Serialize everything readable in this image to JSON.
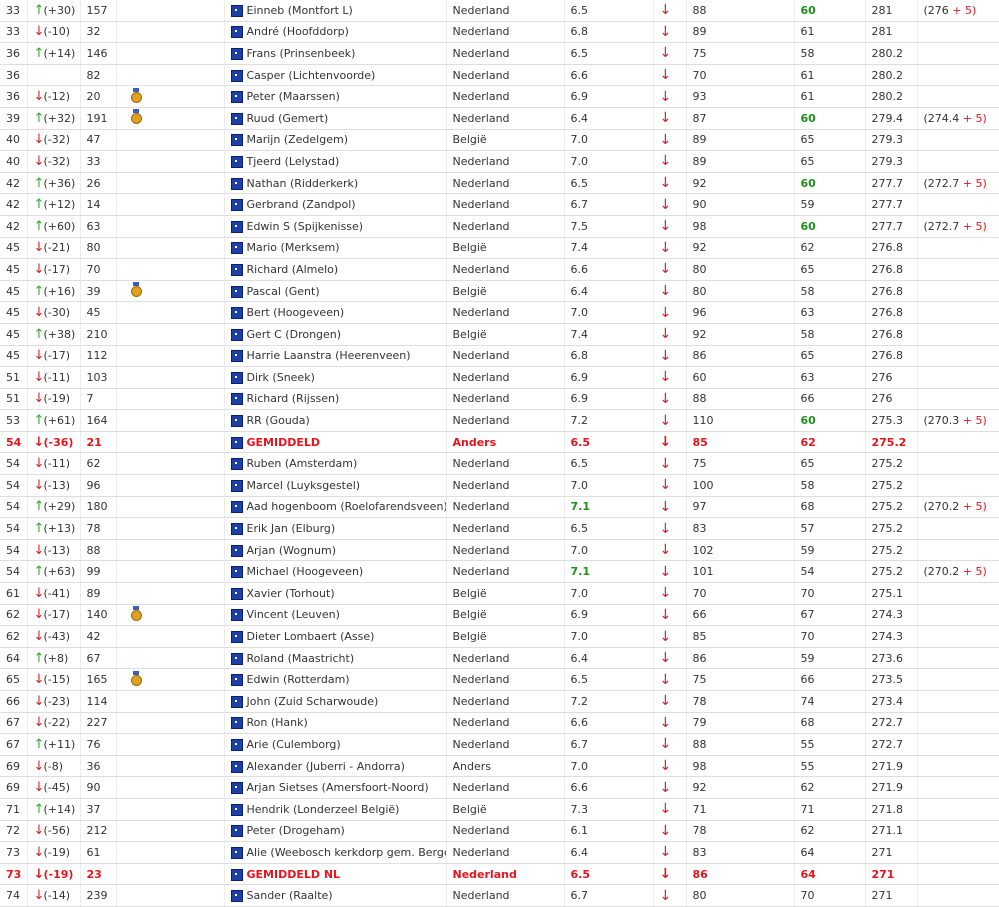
{
  "rows": [
    {
      "rank": "33",
      "dir": "up",
      "change": "(+30)",
      "prev": "157",
      "medal": "",
      "name": "Einneb (Montfort L)",
      "country": "Nederland",
      "score": "6.5",
      "score_green": false,
      "v1": "88",
      "v2": "60",
      "v2_green": true,
      "total": "281",
      "bonus_base": "(276",
      "bonus_add": "+ 5)",
      "avg": false
    },
    {
      "rank": "33",
      "dir": "down",
      "change": "(-10)",
      "prev": "32",
      "medal": "",
      "name": "André (Hoofddorp)",
      "country": "Nederland",
      "score": "6.8",
      "score_green": false,
      "v1": "89",
      "v2": "61",
      "v2_green": false,
      "total": "281",
      "bonus_base": "",
      "bonus_add": "",
      "avg": false
    },
    {
      "rank": "36",
      "dir": "up",
      "change": "(+14)",
      "prev": "146",
      "medal": "",
      "name": "Frans (Prinsenbeek)",
      "country": "Nederland",
      "score": "6.5",
      "score_green": false,
      "v1": "75",
      "v2": "58",
      "v2_green": false,
      "total": "280.2",
      "bonus_base": "",
      "bonus_add": "",
      "avg": false
    },
    {
      "rank": "36",
      "dir": "",
      "change": "",
      "prev": "82",
      "medal": "",
      "name": "Casper (Lichtenvoorde)",
      "country": "Nederland",
      "score": "6.6",
      "score_green": false,
      "v1": "70",
      "v2": "61",
      "v2_green": false,
      "total": "280.2",
      "bonus_base": "",
      "bonus_add": "",
      "avg": false
    },
    {
      "rank": "36",
      "dir": "down",
      "change": "(-12)",
      "prev": "20",
      "medal": "medal-icon",
      "name": "Peter (Maarssen)",
      "country": "Nederland",
      "score": "6.9",
      "score_green": false,
      "v1": "93",
      "v2": "61",
      "v2_green": false,
      "total": "280.2",
      "bonus_base": "",
      "bonus_add": "",
      "avg": false
    },
    {
      "rank": "39",
      "dir": "up",
      "change": "(+32)",
      "prev": "191",
      "medal": "medal-icon",
      "name": "Ruud (Gemert)",
      "country": "Nederland",
      "score": "6.4",
      "score_green": false,
      "v1": "87",
      "v2": "60",
      "v2_green": true,
      "total": "279.4",
      "bonus_base": "(274.4",
      "bonus_add": "+ 5)",
      "avg": false
    },
    {
      "rank": "40",
      "dir": "down",
      "change": "(-32)",
      "prev": "47",
      "medal": "",
      "name": "Marijn (Zedelgem)",
      "country": "België",
      "score": "7.0",
      "score_green": false,
      "v1": "89",
      "v2": "65",
      "v2_green": false,
      "total": "279.3",
      "bonus_base": "",
      "bonus_add": "",
      "avg": false
    },
    {
      "rank": "40",
      "dir": "down",
      "change": "(-32)",
      "prev": "33",
      "medal": "",
      "name": "Tjeerd (Lelystad)",
      "country": "Nederland",
      "score": "7.0",
      "score_green": false,
      "v1": "89",
      "v2": "65",
      "v2_green": false,
      "total": "279.3",
      "bonus_base": "",
      "bonus_add": "",
      "avg": false
    },
    {
      "rank": "42",
      "dir": "up",
      "change": "(+36)",
      "prev": "26",
      "medal": "",
      "name": "Nathan (Ridderkerk)",
      "country": "Nederland",
      "score": "6.5",
      "score_green": false,
      "v1": "92",
      "v2": "60",
      "v2_green": true,
      "total": "277.7",
      "bonus_base": "(272.7",
      "bonus_add": "+ 5)",
      "avg": false
    },
    {
      "rank": "42",
      "dir": "up",
      "change": "(+12)",
      "prev": "14",
      "medal": "",
      "name": "Gerbrand (Zandpol)",
      "country": "Nederland",
      "score": "6.7",
      "score_green": false,
      "v1": "90",
      "v2": "59",
      "v2_green": false,
      "total": "277.7",
      "bonus_base": "",
      "bonus_add": "",
      "avg": false
    },
    {
      "rank": "42",
      "dir": "up",
      "change": "(+60)",
      "prev": "63",
      "medal": "",
      "name": "Edwin S (Spijkenisse)",
      "country": "Nederland",
      "score": "7.5",
      "score_green": false,
      "v1": "98",
      "v2": "60",
      "v2_green": true,
      "total": "277.7",
      "bonus_base": "(272.7",
      "bonus_add": "+ 5)",
      "avg": false
    },
    {
      "rank": "45",
      "dir": "down",
      "change": "(-21)",
      "prev": "80",
      "medal": "",
      "name": "Mario (Merksem)",
      "country": "België",
      "score": "7.4",
      "score_green": false,
      "v1": "92",
      "v2": "62",
      "v2_green": false,
      "total": "276.8",
      "bonus_base": "",
      "bonus_add": "",
      "avg": false
    },
    {
      "rank": "45",
      "dir": "down",
      "change": "(-17)",
      "prev": "70",
      "medal": "",
      "name": "Richard (Almelo)",
      "country": "Nederland",
      "score": "6.6",
      "score_green": false,
      "v1": "80",
      "v2": "65",
      "v2_green": false,
      "total": "276.8",
      "bonus_base": "",
      "bonus_add": "",
      "avg": false
    },
    {
      "rank": "45",
      "dir": "up",
      "change": "(+16)",
      "prev": "39",
      "medal": "medal-icon",
      "name": "Pascal (Gent)",
      "country": "België",
      "score": "6.4",
      "score_green": false,
      "v1": "80",
      "v2": "58",
      "v2_green": false,
      "total": "276.8",
      "bonus_base": "",
      "bonus_add": "",
      "avg": false
    },
    {
      "rank": "45",
      "dir": "down",
      "change": "(-30)",
      "prev": "45",
      "medal": "",
      "name": "Bert (Hoogeveen)",
      "country": "Nederland",
      "score": "7.0",
      "score_green": false,
      "v1": "96",
      "v2": "63",
      "v2_green": false,
      "total": "276.8",
      "bonus_base": "",
      "bonus_add": "",
      "avg": false
    },
    {
      "rank": "45",
      "dir": "up",
      "change": "(+38)",
      "prev": "210",
      "medal": "",
      "name": "Gert C (Drongen)",
      "country": "België",
      "score": "7.4",
      "score_green": false,
      "v1": "92",
      "v2": "58",
      "v2_green": false,
      "total": "276.8",
      "bonus_base": "",
      "bonus_add": "",
      "avg": false
    },
    {
      "rank": "45",
      "dir": "down",
      "change": "(-17)",
      "prev": "112",
      "medal": "",
      "name": "Harrie Laanstra (Heerenveen)",
      "country": "Nederland",
      "score": "6.8",
      "score_green": false,
      "v1": "86",
      "v2": "65",
      "v2_green": false,
      "total": "276.8",
      "bonus_base": "",
      "bonus_add": "",
      "avg": false
    },
    {
      "rank": "51",
      "dir": "down",
      "change": "(-11)",
      "prev": "103",
      "medal": "",
      "name": "Dirk (Sneek)",
      "country": "Nederland",
      "score": "6.9",
      "score_green": false,
      "v1": "60",
      "v2": "63",
      "v2_green": false,
      "total": "276",
      "bonus_base": "",
      "bonus_add": "",
      "avg": false
    },
    {
      "rank": "51",
      "dir": "down",
      "change": "(-19)",
      "prev": "7",
      "medal": "",
      "name": "Richard (Rijssen)",
      "country": "Nederland",
      "score": "6.9",
      "score_green": false,
      "v1": "88",
      "v2": "66",
      "v2_green": false,
      "total": "276",
      "bonus_base": "",
      "bonus_add": "",
      "avg": false
    },
    {
      "rank": "53",
      "dir": "up",
      "change": "(+61)",
      "prev": "164",
      "medal": "",
      "name": "RR (Gouda)",
      "country": "Nederland",
      "score": "7.2",
      "score_green": false,
      "v1": "110",
      "v2": "60",
      "v2_green": true,
      "total": "275.3",
      "bonus_base": "(270.3",
      "bonus_add": "+ 5)",
      "avg": false
    },
    {
      "rank": "54",
      "dir": "down",
      "change": "(-36)",
      "prev": "21",
      "medal": "",
      "name": "GEMIDDELD",
      "country": "Anders",
      "score": "6.5",
      "score_green": false,
      "v1": "85",
      "v2": "62",
      "v2_green": false,
      "total": "275.2",
      "bonus_base": "",
      "bonus_add": "",
      "avg": true
    },
    {
      "rank": "54",
      "dir": "down",
      "change": "(-11)",
      "prev": "62",
      "medal": "",
      "name": "Ruben (Amsterdam)",
      "country": "Nederland",
      "score": "6.5",
      "score_green": false,
      "v1": "75",
      "v2": "65",
      "v2_green": false,
      "total": "275.2",
      "bonus_base": "",
      "bonus_add": "",
      "avg": false
    },
    {
      "rank": "54",
      "dir": "down",
      "change": "(-13)",
      "prev": "96",
      "medal": "",
      "name": "Marcel (Luyksgestel)",
      "country": "Nederland",
      "score": "7.0",
      "score_green": false,
      "v1": "100",
      "v2": "58",
      "v2_green": false,
      "total": "275.2",
      "bonus_base": "",
      "bonus_add": "",
      "avg": false
    },
    {
      "rank": "54",
      "dir": "up",
      "change": "(+29)",
      "prev": "180",
      "medal": "",
      "name": "Aad hogenboom (Roelofarendsveen)",
      "country": "Nederland",
      "score": "7.1",
      "score_green": true,
      "v1": "97",
      "v2": "68",
      "v2_green": false,
      "total": "275.2",
      "bonus_base": "(270.2",
      "bonus_add": "+ 5)",
      "avg": false
    },
    {
      "rank": "54",
      "dir": "up",
      "change": "(+13)",
      "prev": "78",
      "medal": "",
      "name": "Erik Jan (Elburg)",
      "country": "Nederland",
      "score": "6.5",
      "score_green": false,
      "v1": "83",
      "v2": "57",
      "v2_green": false,
      "total": "275.2",
      "bonus_base": "",
      "bonus_add": "",
      "avg": false
    },
    {
      "rank": "54",
      "dir": "down",
      "change": "(-13)",
      "prev": "88",
      "medal": "",
      "name": "Arjan (Wognum)",
      "country": "Nederland",
      "score": "7.0",
      "score_green": false,
      "v1": "102",
      "v2": "59",
      "v2_green": false,
      "total": "275.2",
      "bonus_base": "",
      "bonus_add": "",
      "avg": false
    },
    {
      "rank": "54",
      "dir": "up",
      "change": "(+63)",
      "prev": "99",
      "medal": "",
      "name": "Michael (Hoogeveen)",
      "country": "Nederland",
      "score": "7.1",
      "score_green": true,
      "v1": "101",
      "v2": "54",
      "v2_green": false,
      "total": "275.2",
      "bonus_base": "(270.2",
      "bonus_add": "+ 5)",
      "avg": false
    },
    {
      "rank": "61",
      "dir": "down",
      "change": "(-41)",
      "prev": "89",
      "medal": "",
      "name": "Xavier (Torhout)",
      "country": "België",
      "score": "7.0",
      "score_green": false,
      "v1": "70",
      "v2": "70",
      "v2_green": false,
      "total": "275.1",
      "bonus_base": "",
      "bonus_add": "",
      "avg": false
    },
    {
      "rank": "62",
      "dir": "down",
      "change": "(-17)",
      "prev": "140",
      "medal": "medal-icon",
      "name": "Vincent (Leuven)",
      "country": "België",
      "score": "6.9",
      "score_green": false,
      "v1": "66",
      "v2": "67",
      "v2_green": false,
      "total": "274.3",
      "bonus_base": "",
      "bonus_add": "",
      "avg": false
    },
    {
      "rank": "62",
      "dir": "down",
      "change": "(-43)",
      "prev": "42",
      "medal": "",
      "name": "Dieter Lombaert (Asse)",
      "country": "België",
      "score": "7.0",
      "score_green": false,
      "v1": "85",
      "v2": "70",
      "v2_green": false,
      "total": "274.3",
      "bonus_base": "",
      "bonus_add": "",
      "avg": false
    },
    {
      "rank": "64",
      "dir": "up",
      "change": "(+8)",
      "prev": "67",
      "medal": "",
      "name": "Roland (Maastricht)",
      "country": "Nederland",
      "score": "6.4",
      "score_green": false,
      "v1": "86",
      "v2": "59",
      "v2_green": false,
      "total": "273.6",
      "bonus_base": "",
      "bonus_add": "",
      "avg": false
    },
    {
      "rank": "65",
      "dir": "down",
      "change": "(-15)",
      "prev": "165",
      "medal": "medal-icon",
      "name": "Edwin (Rotterdam)",
      "country": "Nederland",
      "score": "6.5",
      "score_green": false,
      "v1": "75",
      "v2": "66",
      "v2_green": false,
      "total": "273.5",
      "bonus_base": "",
      "bonus_add": "",
      "avg": false
    },
    {
      "rank": "66",
      "dir": "down",
      "change": "(-23)",
      "prev": "114",
      "medal": "",
      "name": "John (Zuid Scharwoude)",
      "country": "Nederland",
      "score": "7.2",
      "score_green": false,
      "v1": "78",
      "v2": "74",
      "v2_green": false,
      "total": "273.4",
      "bonus_base": "",
      "bonus_add": "",
      "avg": false
    },
    {
      "rank": "67",
      "dir": "down",
      "change": "(-22)",
      "prev": "227",
      "medal": "",
      "name": "Ron (Hank)",
      "country": "Nederland",
      "score": "6.6",
      "score_green": false,
      "v1": "79",
      "v2": "68",
      "v2_green": false,
      "total": "272.7",
      "bonus_base": "",
      "bonus_add": "",
      "avg": false
    },
    {
      "rank": "67",
      "dir": "up",
      "change": "(+11)",
      "prev": "76",
      "medal": "",
      "name": "Arie (Culemborg)",
      "country": "Nederland",
      "score": "6.7",
      "score_green": false,
      "v1": "88",
      "v2": "55",
      "v2_green": false,
      "total": "272.7",
      "bonus_base": "",
      "bonus_add": "",
      "avg": false
    },
    {
      "rank": "69",
      "dir": "down",
      "change": "(-8)",
      "prev": "36",
      "medal": "",
      "name": "Alexander (Juberri - Andorra)",
      "country": "Anders",
      "score": "7.0",
      "score_green": false,
      "v1": "98",
      "v2": "55",
      "v2_green": false,
      "total": "271.9",
      "bonus_base": "",
      "bonus_add": "",
      "avg": false
    },
    {
      "rank": "69",
      "dir": "down",
      "change": "(-45)",
      "prev": "90",
      "medal": "",
      "name": "Arjan Sietses (Amersfoort-Noord)",
      "country": "Nederland",
      "score": "6.6",
      "score_green": false,
      "v1": "92",
      "v2": "62",
      "v2_green": false,
      "total": "271.9",
      "bonus_base": "",
      "bonus_add": "",
      "avg": false
    },
    {
      "rank": "71",
      "dir": "up",
      "change": "(+14)",
      "prev": "37",
      "medal": "",
      "name": "Hendrik (Londerzeel België)",
      "country": "België",
      "score": "7.3",
      "score_green": false,
      "v1": "71",
      "v2": "71",
      "v2_green": false,
      "total": "271.8",
      "bonus_base": "",
      "bonus_add": "",
      "avg": false
    },
    {
      "rank": "72",
      "dir": "down",
      "change": "(-56)",
      "prev": "212",
      "medal": "",
      "name": "Peter (Drogeham)",
      "country": "Nederland",
      "score": "6.1",
      "score_green": false,
      "v1": "78",
      "v2": "62",
      "v2_green": false,
      "total": "271.1",
      "bonus_base": "",
      "bonus_add": "",
      "avg": false
    },
    {
      "rank": "73",
      "dir": "down",
      "change": "(-19)",
      "prev": "61",
      "medal": "",
      "name": "Alie (Weebosch kerkdorp gem. Bergeijk)",
      "country": "Nederland",
      "score": "6.4",
      "score_green": false,
      "v1": "83",
      "v2": "64",
      "v2_green": false,
      "total": "271",
      "bonus_base": "",
      "bonus_add": "",
      "avg": false
    },
    {
      "rank": "73",
      "dir": "down",
      "change": "(-19)",
      "prev": "23",
      "medal": "",
      "name": "GEMIDDELD NL",
      "country": "Nederland",
      "score": "6.5",
      "score_green": false,
      "v1": "86",
      "v2": "64",
      "v2_green": false,
      "total": "271",
      "bonus_base": "",
      "bonus_add": "",
      "avg": true
    },
    {
      "rank": "74",
      "dir": "down",
      "change": "(-14)",
      "prev": "239",
      "medal": "",
      "name": "Sander (Raalte)",
      "country": "Nederland",
      "score": "6.7",
      "score_green": false,
      "v1": "80",
      "v2": "70",
      "v2_green": false,
      "total": "271",
      "bonus_base": "",
      "bonus_add": "",
      "avg": false
    }
  ]
}
